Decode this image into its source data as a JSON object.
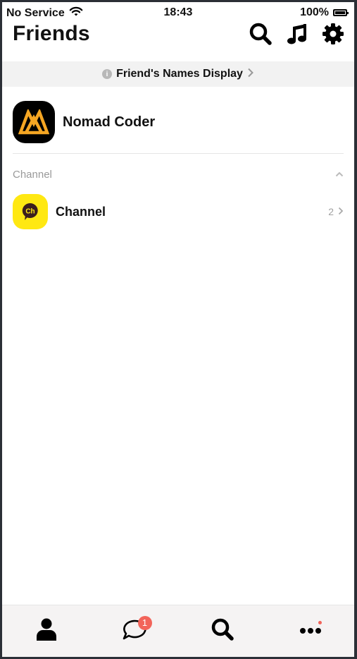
{
  "status_bar": {
    "carrier": "No Service",
    "time": "18:43",
    "battery": "100%"
  },
  "header": {
    "title": "Friends",
    "icons": [
      "search-icon",
      "music-note-icon",
      "gear-icon"
    ]
  },
  "banner": {
    "label": "Friend's Names Display",
    "info_glyph": "i"
  },
  "profile": {
    "name": "Nomad Coder",
    "avatar": "nomad-coder-logo"
  },
  "channel_section": {
    "title": "Channel",
    "items": [
      {
        "name": "Channel",
        "count": "2",
        "avatar_text": "Ch"
      }
    ]
  },
  "tab_bar": {
    "tabs": [
      {
        "name": "friends",
        "icon": "person-icon"
      },
      {
        "name": "chats",
        "icon": "chat-bubble-icon",
        "badge": "1"
      },
      {
        "name": "search",
        "icon": "search-icon"
      },
      {
        "name": "more",
        "icon": "more-dots-icon",
        "dot": true
      }
    ]
  },
  "colors": {
    "accent_yellow": "#ffe812",
    "logo_orange": "#f5a623",
    "badge_red": "#f2645a",
    "banner_bg": "#f2f2f2"
  }
}
